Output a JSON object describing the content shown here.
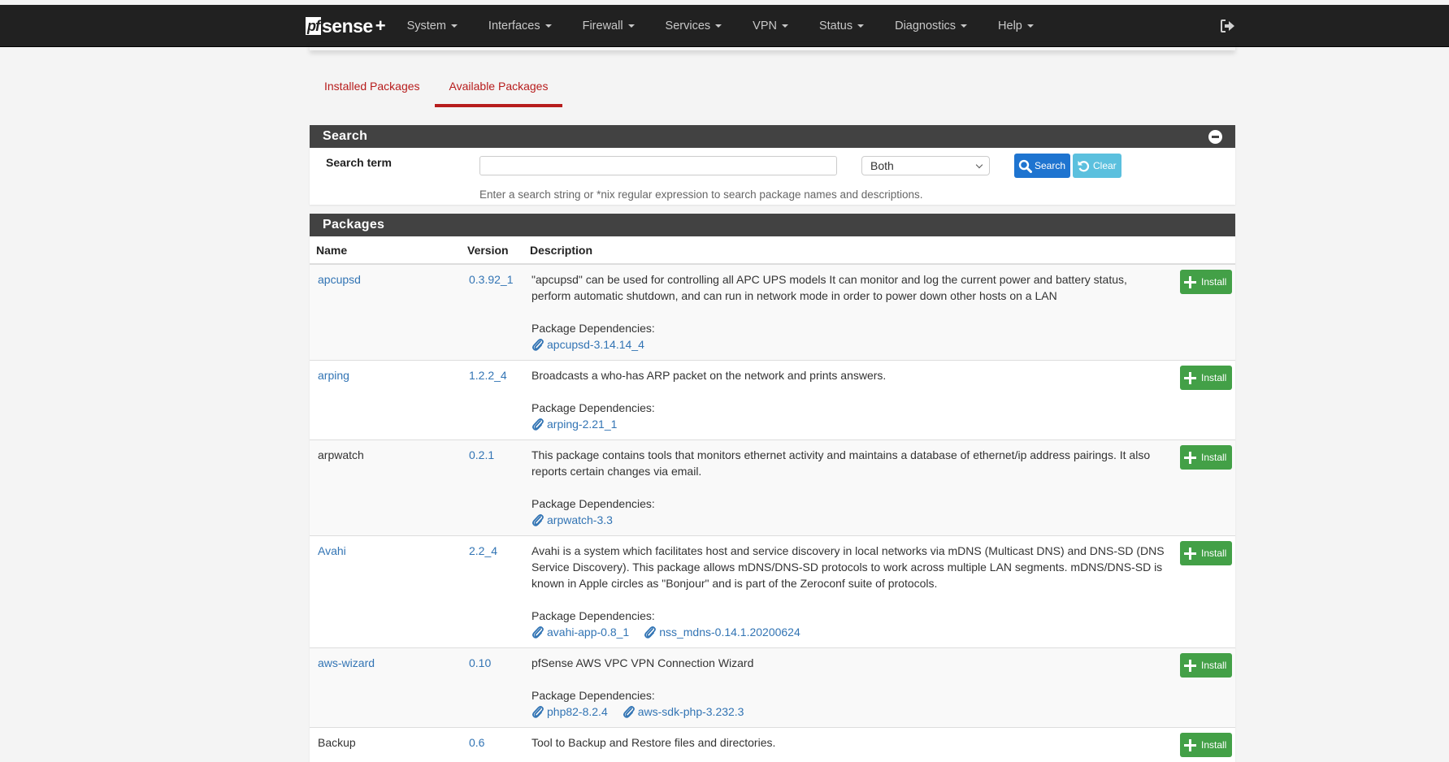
{
  "navbar": {
    "brand": {
      "pf": "pf",
      "sense": "sense",
      "plus": "+"
    },
    "items": [
      {
        "label": "System"
      },
      {
        "label": "Interfaces"
      },
      {
        "label": "Firewall"
      },
      {
        "label": "Services"
      },
      {
        "label": "VPN"
      },
      {
        "label": "Status"
      },
      {
        "label": "Diagnostics"
      },
      {
        "label": "Help"
      }
    ],
    "logout_icon": "sign-out-icon"
  },
  "tabs": [
    {
      "label": "Installed Packages",
      "active": false
    },
    {
      "label": "Available Packages",
      "active": true
    }
  ],
  "search_panel": {
    "title": "Search",
    "term_label": "Search term",
    "term_value": "",
    "term_placeholder": "",
    "scope_selected": "Both",
    "search_button": "Search",
    "clear_button": "Clear",
    "help_text": "Enter a search string or *nix regular expression to search package names and descriptions."
  },
  "packages_panel": {
    "title": "Packages",
    "columns": [
      "Name",
      "Version",
      "Description"
    ],
    "deps_label": "Package Dependencies:",
    "install_label": "Install",
    "rows": [
      {
        "name": "apcupsd",
        "name_is_link": true,
        "version": "0.3.92_1",
        "description": "\"apcupsd\" can be used for controlling all APC UPS models It can monitor and log the current power and battery status, perform automatic shutdown, and can run in network mode in order to power down other hosts on a LAN",
        "dependencies": [
          "apcupsd-3.14.14_4"
        ]
      },
      {
        "name": "arping",
        "name_is_link": true,
        "version": "1.2.2_4",
        "description": "Broadcasts a who-has ARP packet on the network and prints answers.",
        "dependencies": [
          "arping-2.21_1"
        ]
      },
      {
        "name": "arpwatch",
        "name_is_link": false,
        "version": "0.2.1",
        "description": "This package contains tools that monitors ethernet activity and maintains a database of ethernet/ip address pairings. It also reports certain changes via email.",
        "dependencies": [
          "arpwatch-3.3"
        ]
      },
      {
        "name": "Avahi",
        "name_is_link": true,
        "version": "2.2_4",
        "description": "Avahi is a system which facilitates host and service discovery in local networks via mDNS (Multicast DNS) and DNS-SD (DNS Service Discovery). This package allows mDNS/DNS-SD protocols to work across multiple LAN segments. mDNS/DNS-SD is known in Apple circles as \"Bonjour\" and is part of the Zeroconf suite of protocols.",
        "dependencies": [
          "avahi-app-0.8_1",
          "nss_mdns-0.14.1.20200624"
        ]
      },
      {
        "name": "aws-wizard",
        "name_is_link": true,
        "version": "0.10",
        "description": "pfSense AWS VPC VPN Connection Wizard",
        "dependencies": [
          "php82-8.2.4",
          "aws-sdk-php-3.232.3"
        ]
      },
      {
        "name": "Backup",
        "name_is_link": false,
        "version": "0.6",
        "description": "Tool to Backup and Restore files and directories.",
        "dependencies": []
      }
    ]
  },
  "colors": {
    "navbar_bg": "#212121",
    "panel_heading_bg": "#424242",
    "tab_accent": "#b71c1c",
    "link": "#3274b4",
    "search_button": "#1e74d0",
    "clear_button": "#5bc0de",
    "install_button": "#43a047"
  }
}
